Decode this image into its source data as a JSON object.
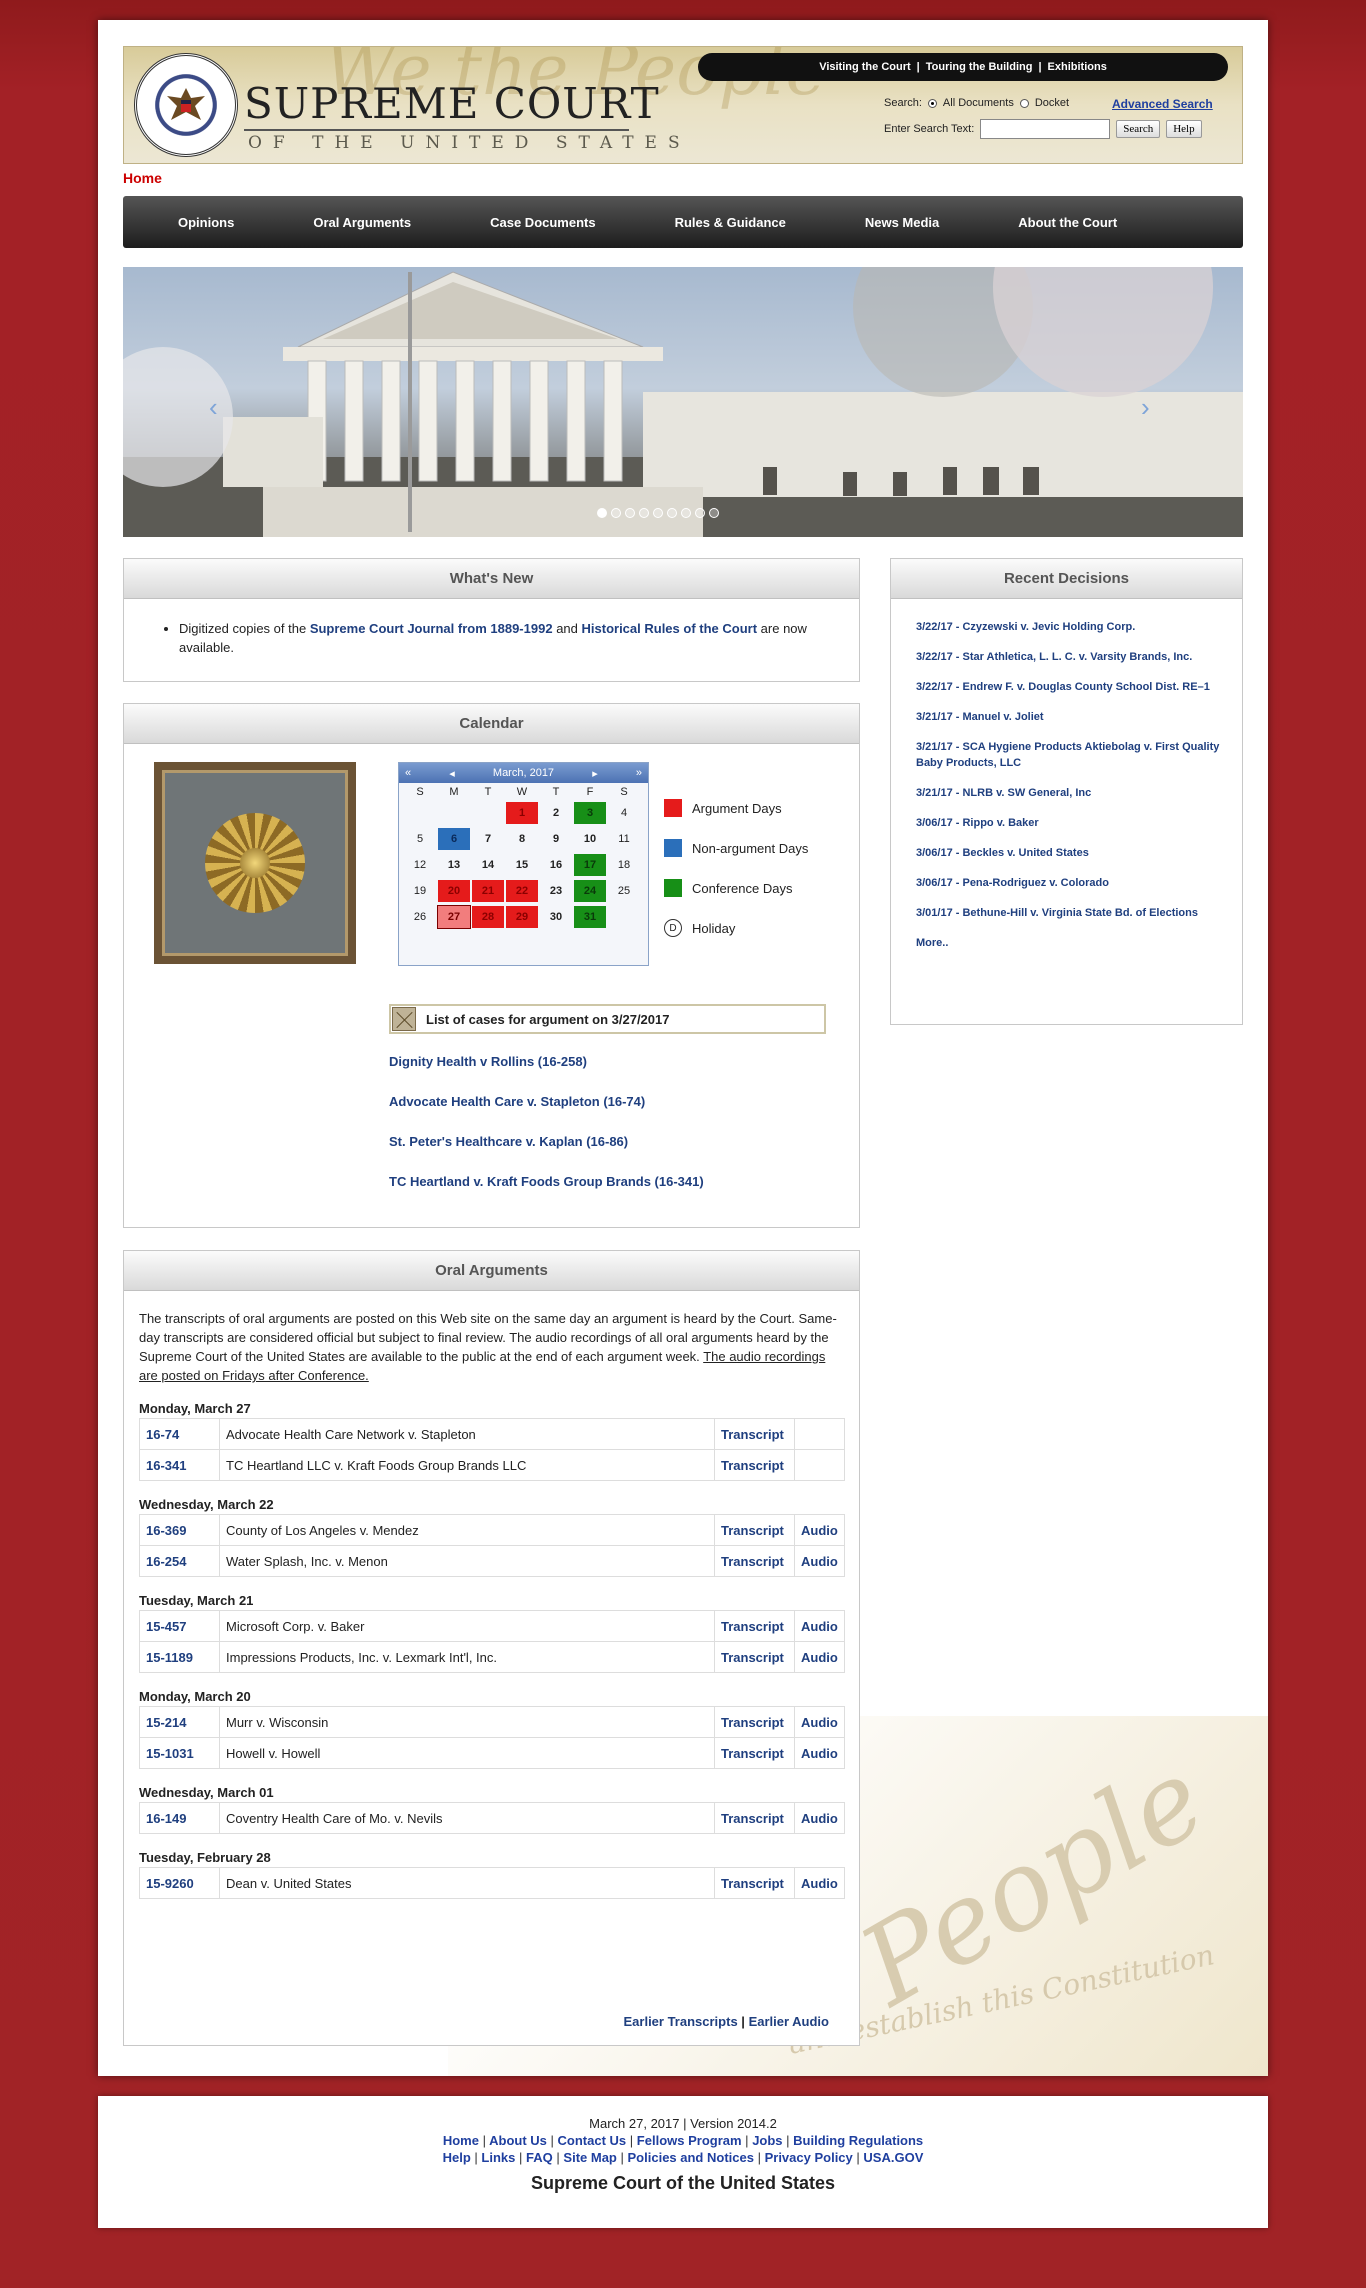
{
  "header": {
    "title": "SUPREME COURT",
    "subtitle": "OF THE UNITED STATES",
    "background_script": "We the People",
    "top_links": [
      "Visiting the Court",
      "Touring the Building",
      "Exhibitions"
    ],
    "search_label": "Search:",
    "search_all": "All Documents",
    "search_docket": "Docket",
    "advanced_search": "Advanced Search",
    "search_text_label": "Enter Search Text:",
    "search_button": "Search",
    "help_button": "Help"
  },
  "breadcrumb": "Home",
  "nav": [
    "Opinions",
    "Oral Arguments",
    "Case Documents",
    "Rules & Guidance",
    "News Media",
    "About the Court"
  ],
  "hero": {
    "slides": 9,
    "active": 1
  },
  "whats_new": {
    "title": "What's New",
    "text_prefix": "Digitized copies of the",
    "link1": "Supreme Court Journal from 1889-1992",
    "text_mid": "and",
    "link2": "Historical Rules of the Court",
    "text_suffix": "are now available."
  },
  "calendar": {
    "title": "Calendar",
    "month": "March, 2017",
    "days_of_week": [
      "S",
      "M",
      "T",
      "W",
      "T",
      "F",
      "S"
    ],
    "weeks": [
      [
        {
          "d": ""
        },
        {
          "d": ""
        },
        {
          "d": ""
        },
        {
          "d": "1",
          "t": "arg"
        },
        {
          "d": "2"
        },
        {
          "d": "3",
          "t": "conf"
        },
        {
          "d": "4",
          "t": "weekend"
        }
      ],
      [
        {
          "d": "5",
          "t": "weekend"
        },
        {
          "d": "6",
          "t": "nonarg"
        },
        {
          "d": "7"
        },
        {
          "d": "8"
        },
        {
          "d": "9"
        },
        {
          "d": "10"
        },
        {
          "d": "11",
          "t": "weekend"
        }
      ],
      [
        {
          "d": "12",
          "t": "weekend"
        },
        {
          "d": "13"
        },
        {
          "d": "14"
        },
        {
          "d": "15"
        },
        {
          "d": "16"
        },
        {
          "d": "17",
          "t": "conf"
        },
        {
          "d": "18",
          "t": "weekend"
        }
      ],
      [
        {
          "d": "19",
          "t": "weekend"
        },
        {
          "d": "20",
          "t": "arg"
        },
        {
          "d": "21",
          "t": "arg"
        },
        {
          "d": "22",
          "t": "arg"
        },
        {
          "d": "23"
        },
        {
          "d": "24",
          "t": "conf"
        },
        {
          "d": "25",
          "t": "weekend"
        }
      ],
      [
        {
          "d": "26",
          "t": "weekend"
        },
        {
          "d": "27",
          "t": "today"
        },
        {
          "d": "28",
          "t": "arg"
        },
        {
          "d": "29",
          "t": "arg"
        },
        {
          "d": "30"
        },
        {
          "d": "31",
          "t": "conf"
        },
        {
          "d": ""
        }
      ]
    ],
    "legend": {
      "argument": "Argument Days",
      "nonargument": "Non-argument Days",
      "conference": "Conference Days",
      "holiday": "Holiday"
    },
    "colors": {
      "argument": "#e51b1b",
      "nonargument": "#2b6fba",
      "conference": "#178f17"
    },
    "case_list_title": "List of cases for argument on 3/27/2017",
    "cases": [
      "Dignity Health v Rollins (16-258)",
      "Advocate Health Care v. Stapleton (16-74)",
      "St. Peter's Healthcare v. Kaplan (16-86)",
      "TC Heartland v. Kraft Foods Group Brands (16-341)"
    ]
  },
  "recent_decisions": {
    "title": "Recent Decisions",
    "items": [
      "3/22/17 - Czyzewski v. Jevic Holding Corp.",
      "3/22/17 - Star Athletica, L. L. C. v. Varsity Brands, Inc.",
      "3/22/17 - Endrew F. v. Douglas County School Dist. RE–1",
      "3/21/17 - Manuel v. Joliet",
      "3/21/17 - SCA Hygiene Products Aktiebolag v. First Quality Baby Products, LLC",
      "3/21/17 - NLRB v. SW General, Inc",
      "3/06/17 - Rippo v. Baker",
      "3/06/17 - Beckles v. United States",
      "3/06/17 - Pena-Rodriguez v. Colorado",
      "3/01/17 - Bethune-Hill v. Virginia State Bd. of Elections"
    ],
    "more": "More.."
  },
  "oral_arguments": {
    "title": "Oral Arguments",
    "intro": "The transcripts of oral arguments are posted on this Web site on the same day an argument is heard by the Court. Same-day transcripts are considered official but subject to final review. The audio recordings of all oral arguments heard by the Supreme Court of the United States are available to the public at the end of each argument week.",
    "intro_underlined": "The audio recordings are posted on Fridays after Conference.",
    "transcript_label": "Transcript",
    "audio_label": "Audio",
    "days": [
      {
        "date": "Monday, March 27",
        "rows": [
          {
            "num": "16-74",
            "name": "Advocate Health Care Network v. Stapleton",
            "audio": false
          },
          {
            "num": "16-341",
            "name": "TC Heartland LLC v. Kraft Foods Group Brands LLC",
            "audio": false
          }
        ]
      },
      {
        "date": "Wednesday, March 22",
        "rows": [
          {
            "num": "16-369",
            "name": "County of Los Angeles v. Mendez",
            "audio": true
          },
          {
            "num": "16-254",
            "name": "Water Splash, Inc. v. Menon",
            "audio": true
          }
        ]
      },
      {
        "date": "Tuesday, March 21",
        "rows": [
          {
            "num": "15-457",
            "name": "Microsoft Corp. v. Baker",
            "audio": true
          },
          {
            "num": "15-1189",
            "name": "Impressions Products, Inc. v. Lexmark Int'l, Inc.",
            "audio": true
          }
        ]
      },
      {
        "date": "Monday, March 20",
        "rows": [
          {
            "num": "15-214",
            "name": "Murr v. Wisconsin",
            "audio": true
          },
          {
            "num": "15-1031",
            "name": "Howell v. Howell",
            "audio": true
          }
        ]
      },
      {
        "date": "Wednesday, March 01",
        "rows": [
          {
            "num": "16-149",
            "name": "Coventry Health Care of Mo. v. Nevils",
            "audio": true
          }
        ]
      },
      {
        "date": "Tuesday, February 28",
        "rows": [
          {
            "num": "15-9260",
            "name": "Dean v. United States",
            "audio": true
          }
        ]
      }
    ],
    "earlier_transcripts": "Earlier Transcripts",
    "earlier_audio": "Earlier Audio",
    "earlier_separator": "|"
  },
  "footer": {
    "date_version": "March 27, 2017 | Version 2014.2",
    "links_row1": [
      "Home",
      "About Us",
      "Contact Us",
      "Fellows Program",
      "Jobs",
      "Building Regulations"
    ],
    "links_row2": [
      "Help",
      "Links",
      "FAQ",
      "Site Map",
      "Policies and Notices",
      "Privacy Policy",
      "USA.GOV"
    ],
    "separator": "|",
    "name": "Supreme Court of the United States"
  }
}
